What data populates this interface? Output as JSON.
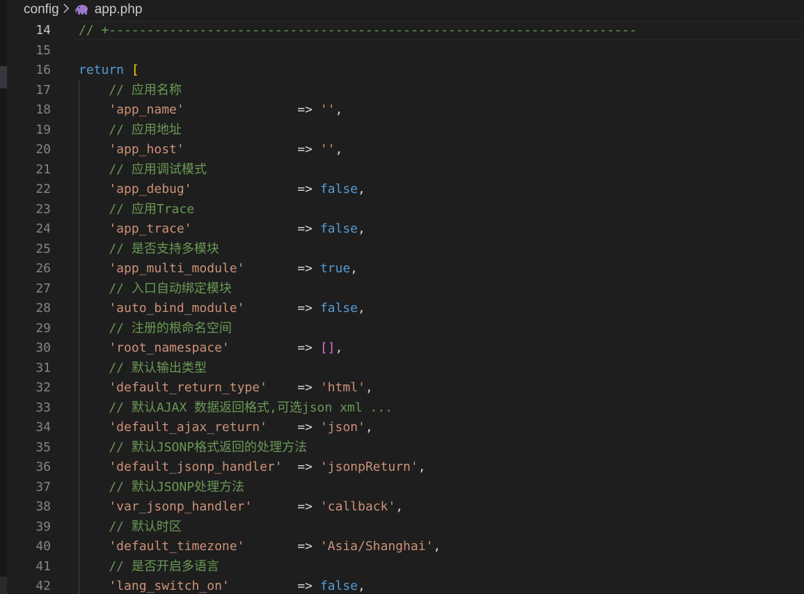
{
  "breadcrumb": {
    "folder": "config",
    "file": "app.php"
  },
  "icons": {
    "separator": "chevron-right-icon",
    "file_type": "php-elephant-icon"
  },
  "colors": {
    "background": "#1e1e1e",
    "line_number": "#858585",
    "comment": "#6a9955",
    "string": "#ce9178",
    "keyword": "#569cd6",
    "bracket": "#ffd700",
    "bracket_inner": "#da70d6",
    "php_icon": "#9b79cc"
  },
  "editor": {
    "active_line": "14",
    "lines": [
      {
        "num": "14",
        "kind": "comment",
        "comment": "// +----------------------------------------------------------------------"
      },
      {
        "num": "15",
        "kind": "blank"
      },
      {
        "num": "16",
        "kind": "return",
        "keyword": "return",
        "bracket": "["
      },
      {
        "num": "17",
        "kind": "comment",
        "comment": "    // 应用名称"
      },
      {
        "num": "18",
        "kind": "entry",
        "key": "    'app_name'",
        "pad": "               ",
        "op": "=>",
        "valtype": "str",
        "value": "''"
      },
      {
        "num": "19",
        "kind": "comment",
        "comment": "    // 应用地址"
      },
      {
        "num": "20",
        "kind": "entry",
        "key": "    'app_host'",
        "pad": "               ",
        "op": "=>",
        "valtype": "str",
        "value": "''"
      },
      {
        "num": "21",
        "kind": "comment",
        "comment": "    // 应用调试模式"
      },
      {
        "num": "22",
        "kind": "entry",
        "key": "    'app_debug'",
        "pad": "              ",
        "op": "=>",
        "valtype": "bool",
        "value": "false"
      },
      {
        "num": "23",
        "kind": "comment",
        "comment": "    // 应用Trace"
      },
      {
        "num": "24",
        "kind": "entry",
        "key": "    'app_trace'",
        "pad": "              ",
        "op": "=>",
        "valtype": "bool",
        "value": "false"
      },
      {
        "num": "25",
        "kind": "comment",
        "comment": "    // 是否支持多模块"
      },
      {
        "num": "26",
        "kind": "entry",
        "key": "    'app_multi_module'",
        "pad": "       ",
        "op": "=>",
        "valtype": "bool",
        "value": "true"
      },
      {
        "num": "27",
        "kind": "comment",
        "comment": "    // 入口自动绑定模块"
      },
      {
        "num": "28",
        "kind": "entry",
        "key": "    'auto_bind_module'",
        "pad": "       ",
        "op": "=>",
        "valtype": "bool",
        "value": "false"
      },
      {
        "num": "29",
        "kind": "comment",
        "comment": "    // 注册的根命名空间"
      },
      {
        "num": "30",
        "kind": "entry",
        "key": "    'root_namespace'",
        "pad": "         ",
        "op": "=>",
        "valtype": "arr",
        "value": "[]"
      },
      {
        "num": "31",
        "kind": "comment",
        "comment": "    // 默认输出类型"
      },
      {
        "num": "32",
        "kind": "entry",
        "key": "    'default_return_type'",
        "pad": "    ",
        "op": "=>",
        "valtype": "str",
        "value": "'html'"
      },
      {
        "num": "33",
        "kind": "comment",
        "comment": "    // 默认AJAX 数据返回格式,可选json xml ..."
      },
      {
        "num": "34",
        "kind": "entry",
        "key": "    'default_ajax_return'",
        "pad": "    ",
        "op": "=>",
        "valtype": "str",
        "value": "'json'"
      },
      {
        "num": "35",
        "kind": "comment",
        "comment": "    // 默认JSONP格式返回的处理方法"
      },
      {
        "num": "36",
        "kind": "entry",
        "key": "    'default_jsonp_handler'",
        "pad": "  ",
        "op": "=>",
        "valtype": "str",
        "value": "'jsonpReturn'"
      },
      {
        "num": "37",
        "kind": "comment",
        "comment": "    // 默认JSONP处理方法"
      },
      {
        "num": "38",
        "kind": "entry",
        "key": "    'var_jsonp_handler'",
        "pad": "      ",
        "op": "=>",
        "valtype": "str",
        "value": "'callback'"
      },
      {
        "num": "39",
        "kind": "comment",
        "comment": "    // 默认时区"
      },
      {
        "num": "40",
        "kind": "entry",
        "key": "    'default_timezone'",
        "pad": "       ",
        "op": "=>",
        "valtype": "str",
        "value": "'Asia/Shanghai'"
      },
      {
        "num": "41",
        "kind": "comment",
        "comment": "    // 是否开启多语言"
      },
      {
        "num": "42",
        "kind": "entry",
        "key": "    'lang_switch_on'",
        "pad": "         ",
        "op": "=>",
        "valtype": "bool",
        "value": "false"
      }
    ]
  }
}
